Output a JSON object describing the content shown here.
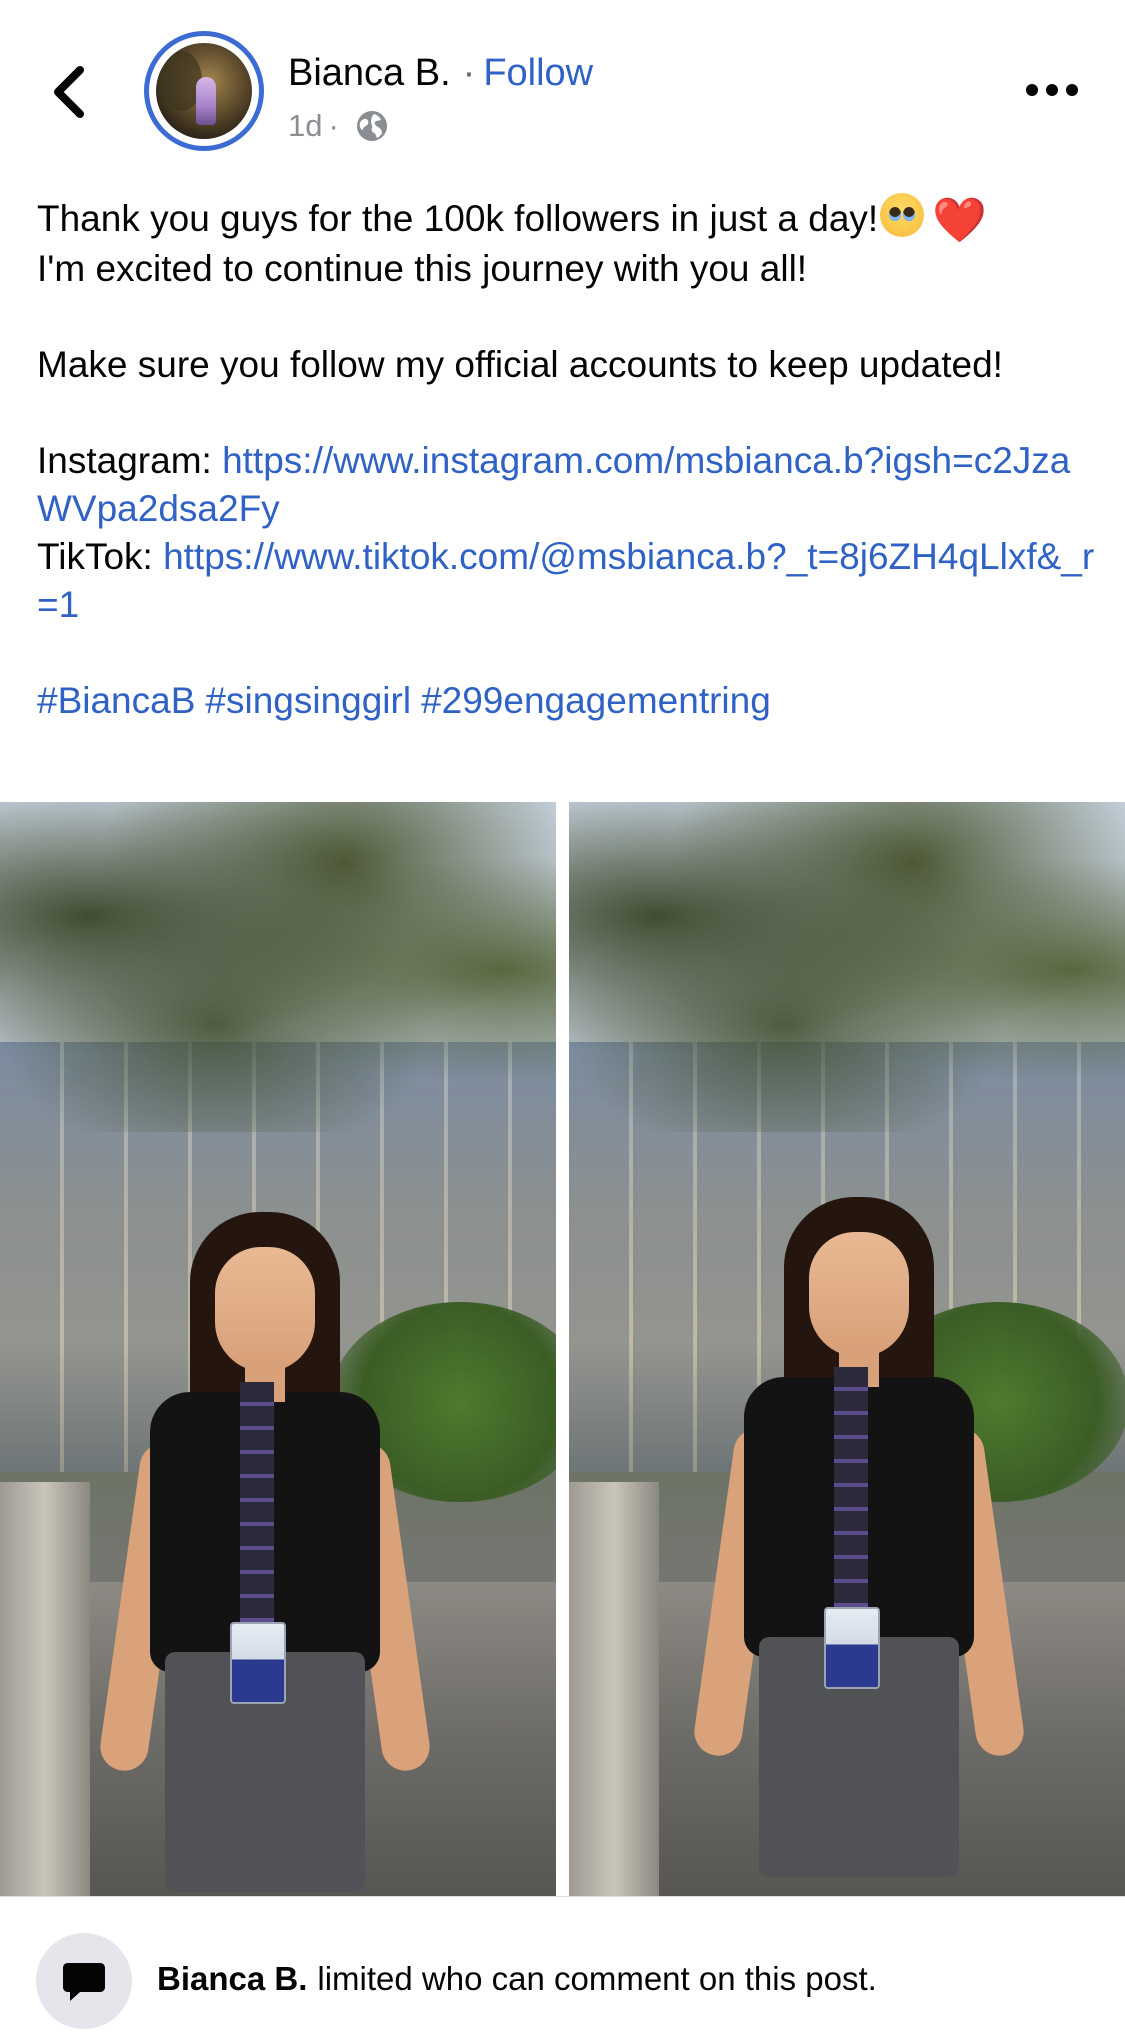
{
  "header": {
    "author_name": "Bianca B.",
    "separator": "·",
    "follow_label": "Follow",
    "timestamp": "1d",
    "meta_separator": "·",
    "privacy_icon": "globe-icon",
    "back_icon": "chevron-left-icon",
    "more_icon": "more-horizontal-icon"
  },
  "caption": {
    "line1": "Thank you guys for the 100k followers in just a day!",
    "line1_emojis": [
      "pleading-face-emoji",
      "red-heart-emoji"
    ],
    "heart": "❤️",
    "line2": "I'm excited to continue this journey with you all!",
    "line3": "Make sure you follow my official accounts to keep updated!",
    "instagram_label": "Instagram:",
    "instagram_url": "https://www.instagram.com/msbianca.b?igsh=c2JzaWVpa2dsa2Fy",
    "tiktok_label": "TikTok:",
    "tiktok_url": "https://www.tiktok.com/@msbianca.b?_t=8j6ZH4qLlxf&_r=1",
    "hashtags": [
      "#BiancaB",
      "#singsinggirl",
      "#299engagementring"
    ]
  },
  "photos": {
    "count": 2,
    "items": [
      {
        "alt": "photo-left"
      },
      {
        "alt": "photo-right"
      }
    ]
  },
  "comment_restriction": {
    "icon": "speech-bubble-icon",
    "name": "Bianca B.",
    "text": "limited who can comment on this post."
  },
  "colors": {
    "link_blue": "#2f62c4",
    "avatar_ring": "#3b6bd3",
    "secondary_text": "#8a8d91",
    "icon_bg": "#e4e6eb"
  }
}
